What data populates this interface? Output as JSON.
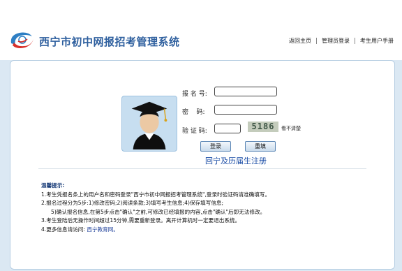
{
  "header": {
    "title": "西宁市初中网报招考管理系统",
    "nav": [
      "返回主页",
      "管理员登录",
      "考生用户手册"
    ]
  },
  "login": {
    "username_label": "报 名 号:",
    "password_label": "密    码:",
    "captcha_label": "验 证 码:",
    "username_value": "",
    "password_value": "",
    "captcha_value": "",
    "captcha_code": "5186",
    "refresh_text": "看不清楚",
    "login_button": "登录",
    "reset_button": "重填",
    "register_link": "回宁及历届生注册"
  },
  "notice": {
    "title": "温馨提示:",
    "lines": [
      "1.考生凭报名条上的用户名和密码登录\"西宁市初中网报招考管理系统\",登录时验证码请准确填写。",
      "2.报名过程分为5步:1)修改密码;2)阅读条款;3)填写考生信息;4)保存填写信息;",
      "5)确认报名信息,在第5步点击\"确认\"之前,可修改已经填报的内容,点击\"确认\"后即无法修改。",
      "3.考生登陆后无操作时间超过15分钟,需要重新登录。离开计算机时一定要退出系统。"
    ],
    "more_prefix": "4.更多信息请访问:",
    "more_link": "西宁教育网。"
  },
  "colors": {
    "title_blue": "#2e5f9e",
    "link_blue": "#1d4fa7",
    "page_bg": "#dbe8f3",
    "panel_border": "#b5cde2"
  },
  "icons": [
    "logo-icon",
    "graduate-avatar-icon"
  ]
}
